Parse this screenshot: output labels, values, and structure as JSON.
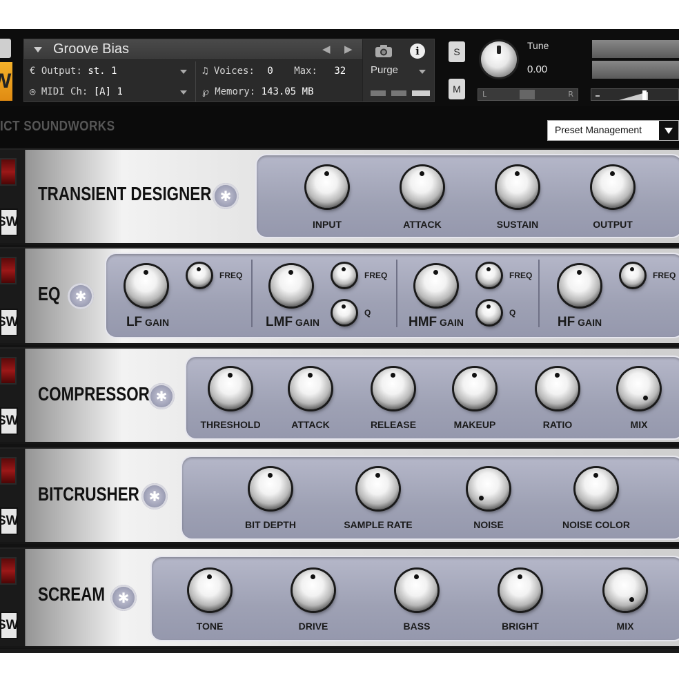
{
  "header": {
    "instrument_name": "Groove Bias",
    "output_label": "Output:",
    "output_value": "st. 1",
    "voices_label": "Voices:",
    "voices_value": "0",
    "max_label": "Max:",
    "max_value": "32",
    "midi_label": "MIDI Ch:",
    "midi_value": "[A]  1",
    "memory_label": "Memory:",
    "memory_value": "143.05 MB",
    "purge_label": "Purge",
    "solo_label": "S",
    "mute_label": "M",
    "tune_label": "Tune",
    "tune_value": "0.00",
    "pan_left": "L",
    "pan_right": "R",
    "logo_letter": "W"
  },
  "brand": {
    "name": "ICT SOUNDWORKS",
    "preset_label": "Preset Management"
  },
  "modules": {
    "transient": {
      "title": "TRANSIENT DESIGNER",
      "knobs": [
        "INPUT",
        "ATTACK",
        "SUSTAIN",
        "OUTPUT"
      ]
    },
    "eq": {
      "title": "EQ",
      "lf_gain": "LF",
      "lmf_gain": "LMF",
      "hmf_gain": "HMF",
      "hf_gain": "HF",
      "gain_suffix": "GAIN",
      "freq": "FREQ",
      "q": "Q"
    },
    "compressor": {
      "title": "COMPRESSOR",
      "knobs": [
        "THRESHOLD",
        "ATTACK",
        "RELEASE",
        "MAKEUP",
        "RATIO",
        "MIX"
      ]
    },
    "bitcrusher": {
      "title": "BITCRUSHER",
      "knobs": [
        "BIT DEPTH",
        "SAMPLE RATE",
        "NOISE",
        "NOISE COLOR"
      ]
    },
    "scream": {
      "title": "SCREAM",
      "knobs": [
        "TONE",
        "DRIVE",
        "BASS",
        "BRIGHT",
        "MIX"
      ]
    },
    "bypass_label": "SW"
  },
  "colors": {
    "accent_logo": "#f4b12a",
    "panel": "#a6a9bc",
    "led_red": "#9c1818",
    "header_bg": "#0d0d0d"
  }
}
